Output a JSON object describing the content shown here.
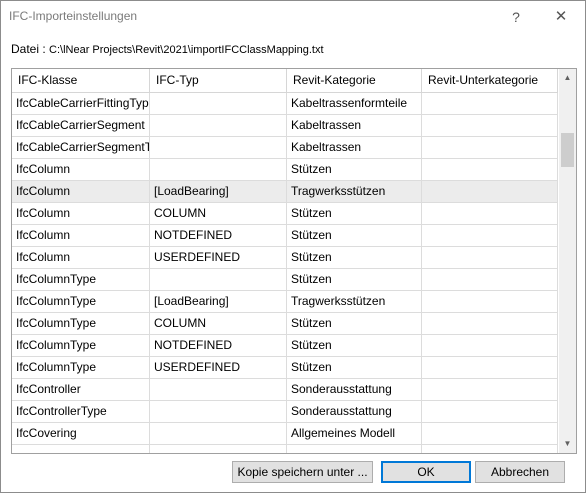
{
  "window": {
    "title": "IFC-Importeinstellungen",
    "help_glyph": "?",
    "close_glyph": "✕"
  },
  "file": {
    "label": "Datei :",
    "path": "C:\\lNear Projects\\Revit\\2021\\importIFCClassMapping.txt"
  },
  "table": {
    "columns": [
      "IFC-Klasse",
      "IFC-Typ",
      "Revit-Kategorie",
      "Revit-Unterkategorie"
    ],
    "selected_row": 4,
    "rows": [
      [
        "IfcCableCarrierFittingTyp",
        "",
        "Kabeltrassenformteile",
        ""
      ],
      [
        "IfcCableCarrierSegment",
        "",
        "Kabeltrassen",
        ""
      ],
      [
        "IfcCableCarrierSegmentT",
        "",
        "Kabeltrassen",
        ""
      ],
      [
        "IfcColumn",
        "",
        "Stützen",
        ""
      ],
      [
        "IfcColumn",
        "[LoadBearing]",
        "Tragwerksstützen",
        ""
      ],
      [
        "IfcColumn",
        "COLUMN",
        "Stützen",
        ""
      ],
      [
        "IfcColumn",
        "NOTDEFINED",
        "Stützen",
        ""
      ],
      [
        "IfcColumn",
        "USERDEFINED",
        "Stützen",
        ""
      ],
      [
        "IfcColumnType",
        "",
        "Stützen",
        ""
      ],
      [
        "IfcColumnType",
        "[LoadBearing]",
        "Tragwerksstützen",
        ""
      ],
      [
        "IfcColumnType",
        "COLUMN",
        "Stützen",
        ""
      ],
      [
        "IfcColumnType",
        "NOTDEFINED",
        "Stützen",
        ""
      ],
      [
        "IfcColumnType",
        "USERDEFINED",
        "Stützen",
        ""
      ],
      [
        "IfcController",
        "",
        "Sonderausstattung",
        ""
      ],
      [
        "IfcControllerType",
        "",
        "Sonderausstattung",
        ""
      ],
      [
        "IfcCovering",
        "",
        "Allgemeines Modell",
        ""
      ],
      [
        "",
        "",
        "",
        ""
      ]
    ]
  },
  "buttons": {
    "save_copy": "Kopie speichern unter ...",
    "ok": "OK",
    "cancel": "Abbrechen"
  },
  "colors": {
    "selected_row": "#ececec",
    "default_button_border": "#0078d7",
    "title_text": "#7a7a7a"
  }
}
